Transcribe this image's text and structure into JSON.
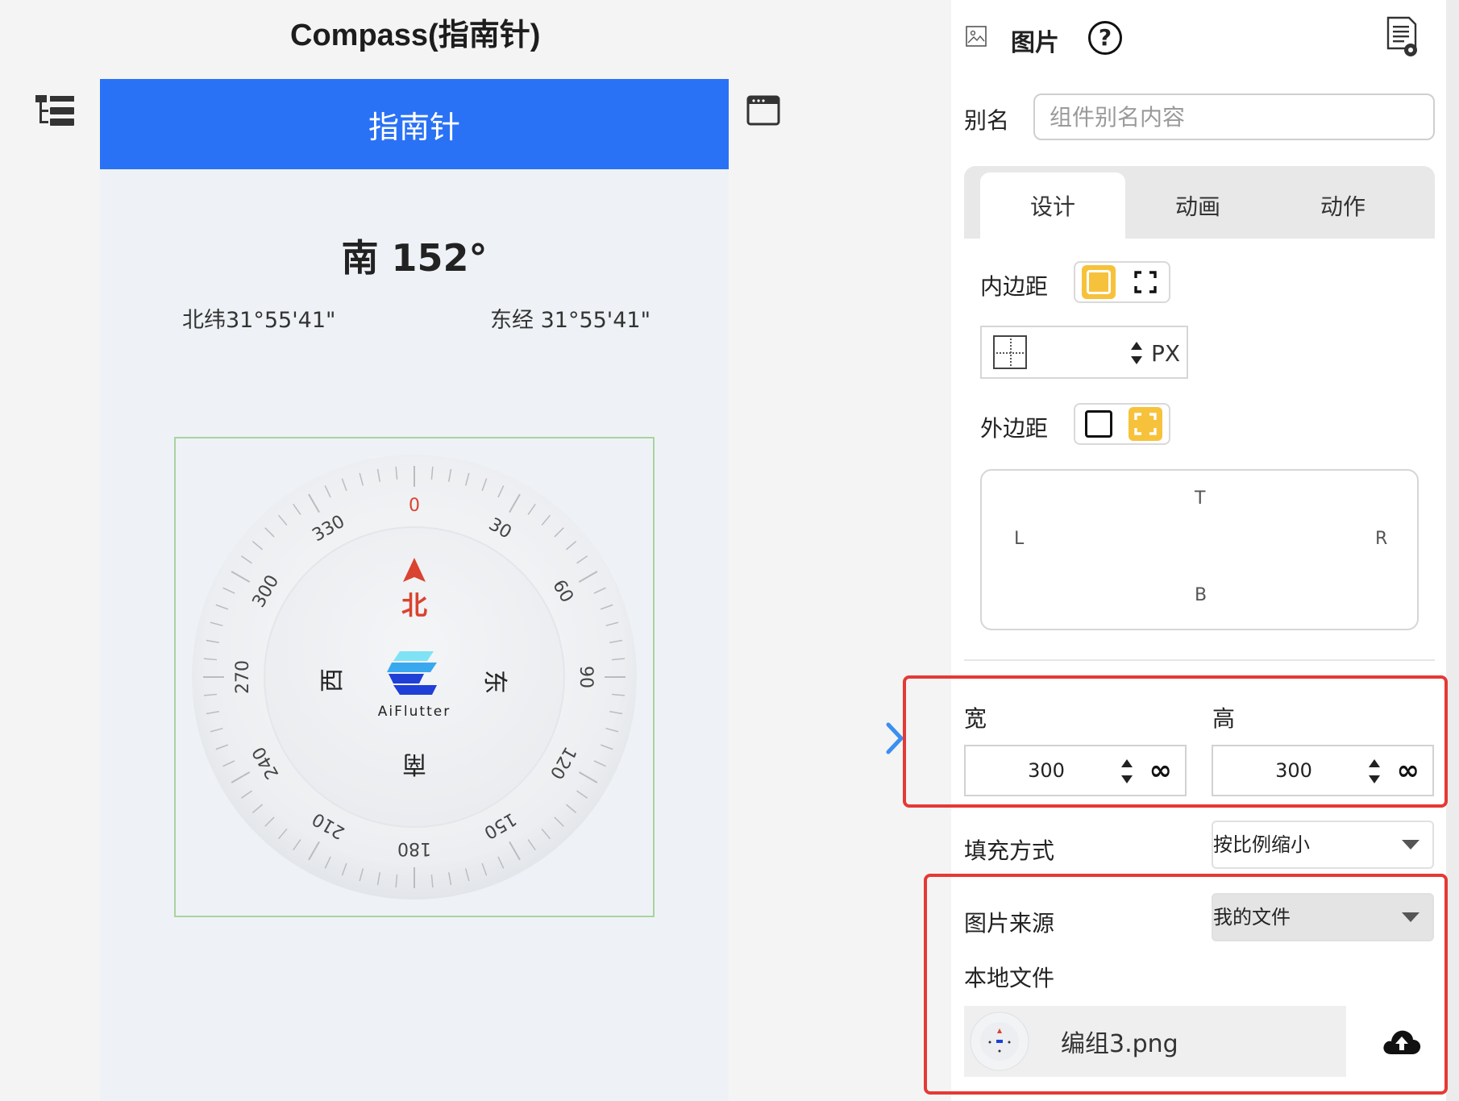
{
  "editor": {
    "title": "Compass(指南针)"
  },
  "phone": {
    "appbar_title": "指南针",
    "heading": "南 152°",
    "latitude": "北纬31°55'41\"",
    "longitude": "东经 31°55'41\""
  },
  "compass": {
    "degree_labels": [
      "0",
      "30",
      "60",
      "90",
      "120",
      "150",
      "180",
      "210",
      "240",
      "270",
      "300",
      "330"
    ],
    "directions": {
      "north": "北",
      "east": "东",
      "south": "南",
      "west": "西"
    },
    "logo_text": "AiFlutter",
    "colors": {
      "north": "#d9432f",
      "logo_light": "#5ad8f0",
      "logo_dark": "#1f3fd6"
    }
  },
  "panel": {
    "title": "图片",
    "alias_label": "别名",
    "alias_placeholder": "组件别名内容",
    "tabs": [
      "设计",
      "动画",
      "动作"
    ],
    "active_tab": "设计",
    "padding_label": "内边距",
    "padding_unit": "PX",
    "margin_label": "外边距",
    "margin_sides": {
      "top": "T",
      "left": "L",
      "right": "R",
      "bottom": "B"
    },
    "width_label": "宽",
    "height_label": "高",
    "width_value": "300",
    "height_value": "300",
    "fill_label": "填充方式",
    "fill_value": "按比例缩小",
    "source_label": "图片来源",
    "source_value": "我的文件",
    "local_file_label": "本地文件",
    "file_name": "编组3.png"
  },
  "colors": {
    "appbar": "#2a72f5",
    "accent_yellow": "#f7c23b",
    "highlight_red": "#e53935"
  }
}
